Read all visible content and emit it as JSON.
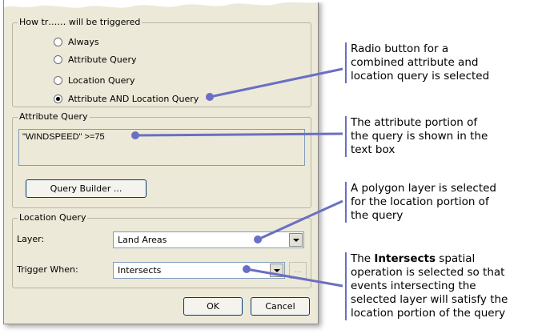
{
  "trigger_group": {
    "legend": "How tr…… will be triggered",
    "options": [
      {
        "label": "Always",
        "selected": false
      },
      {
        "label": "Attribute Query",
        "selected": false
      },
      {
        "label": "Location Query",
        "selected": false
      },
      {
        "label": "Attribute AND Location Query",
        "selected": true
      }
    ]
  },
  "attribute_query": {
    "legend": "Attribute Query",
    "text": "\"WINDSPEED\" >=75",
    "builder_button": "Query Builder ..."
  },
  "location_query": {
    "legend": "Location Query",
    "layer_label": "Layer:",
    "layer_value": "Land Areas",
    "trigger_label": "Trigger When:",
    "trigger_value": "Intersects",
    "ellipsis_button": "..."
  },
  "buttons": {
    "ok": "OK",
    "cancel": "Cancel"
  },
  "annotations": {
    "radio": [
      "Radio button for a",
      "combined attribute and",
      "location query is selected"
    ],
    "attribute": [
      "The attribute portion of",
      "the query is shown in the",
      "text box"
    ],
    "layer": [
      "A polygon layer is selected",
      "for the location portion of",
      "the query"
    ],
    "intersects": {
      "line1_pre": "The ",
      "line1_bold": "Intersects",
      "line1_post": " spatial",
      "rest": [
        "operation is selected so that",
        "events intersecting the",
        "selected layer will satisfy the",
        "location portion of the query"
      ]
    }
  },
  "colors": {
    "annotation_line": "#6a6fc4",
    "dialog_bg": "#ece9d8"
  }
}
